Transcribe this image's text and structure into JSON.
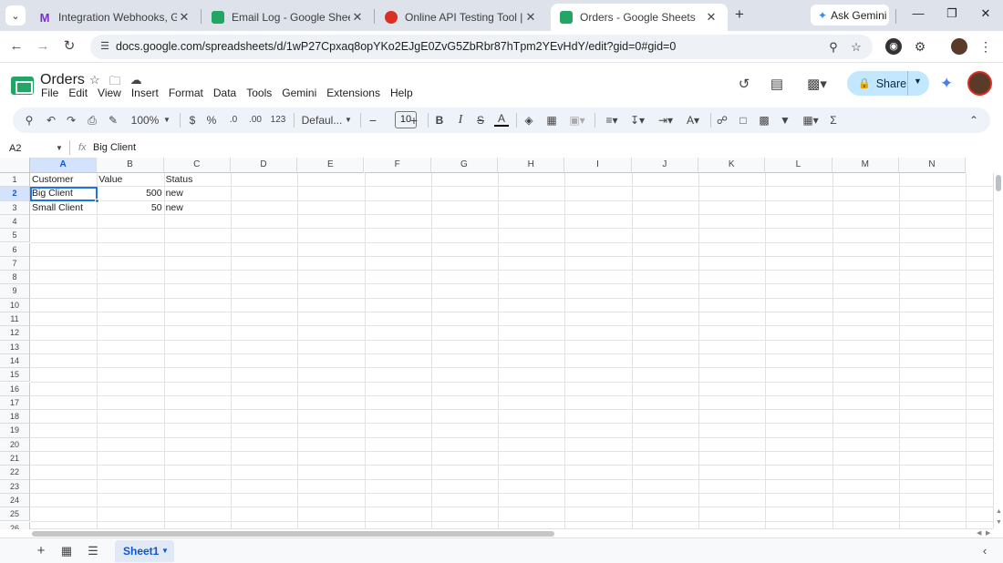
{
  "browser": {
    "tabs": [
      {
        "title": "Integration Webhooks, Google",
        "favicon_color": "#7b2fd1",
        "active": false
      },
      {
        "title": "Email Log - Google Sheets",
        "favicon_color": "#23a566",
        "active": false
      },
      {
        "title": "Online API Testing Tool | Test Yo",
        "favicon_color": "#d93025",
        "active": false
      },
      {
        "title": "Orders - Google Sheets",
        "favicon_color": "#23a566",
        "active": true
      }
    ],
    "new_tab_label": "+",
    "ask_gemini_label": "Ask Gemini",
    "url": "docs.google.com/spreadsheets/d/1wP27Cpxaq8opYKo2EJgE0ZvG5ZbRbr87hTpm2YEvHdY/edit?gid=0#gid=0"
  },
  "sheet_app": {
    "doc_title": "Orders",
    "menu": [
      "File",
      "Edit",
      "View",
      "Insert",
      "Format",
      "Data",
      "Tools",
      "Gemini",
      "Extensions",
      "Help"
    ],
    "share_label": "Share"
  },
  "toolbar": {
    "zoom": "100%",
    "currency": "$",
    "percent": "%",
    "decrease_decimals": ".0",
    "increase_decimals": ".00",
    "number_format": "123",
    "font_name": "Defaul...",
    "font_size": "10"
  },
  "formula_bar": {
    "name_box": "A2",
    "fx_label": "fx",
    "formula": "Big Client"
  },
  "grid": {
    "columns": [
      "A",
      "B",
      "C",
      "D",
      "E",
      "F",
      "G",
      "H",
      "I",
      "J",
      "K",
      "L",
      "M",
      "N"
    ],
    "selected_column": "A",
    "rows": [
      "1",
      "2",
      "3",
      "4",
      "5",
      "6",
      "7",
      "8",
      "9",
      "10",
      "11",
      "12",
      "13",
      "14",
      "15",
      "16",
      "17",
      "18",
      "19",
      "20",
      "21",
      "22",
      "23",
      "24",
      "25",
      "26"
    ],
    "selected_row": "2",
    "selected_cell": "A2",
    "cells": [
      [
        "Customer",
        "Value",
        "Status"
      ],
      [
        "Big Client",
        "500",
        "new"
      ],
      [
        "Small Client",
        "50",
        "new"
      ]
    ]
  },
  "sheets": {
    "tabs": [
      "Sheet1"
    ],
    "active": "Sheet1"
  },
  "colors": {
    "accent": "#1a73e8",
    "share_bg": "#c2e7ff",
    "sheets_green": "#23a566",
    "selection_header": "#d3e3fd"
  }
}
